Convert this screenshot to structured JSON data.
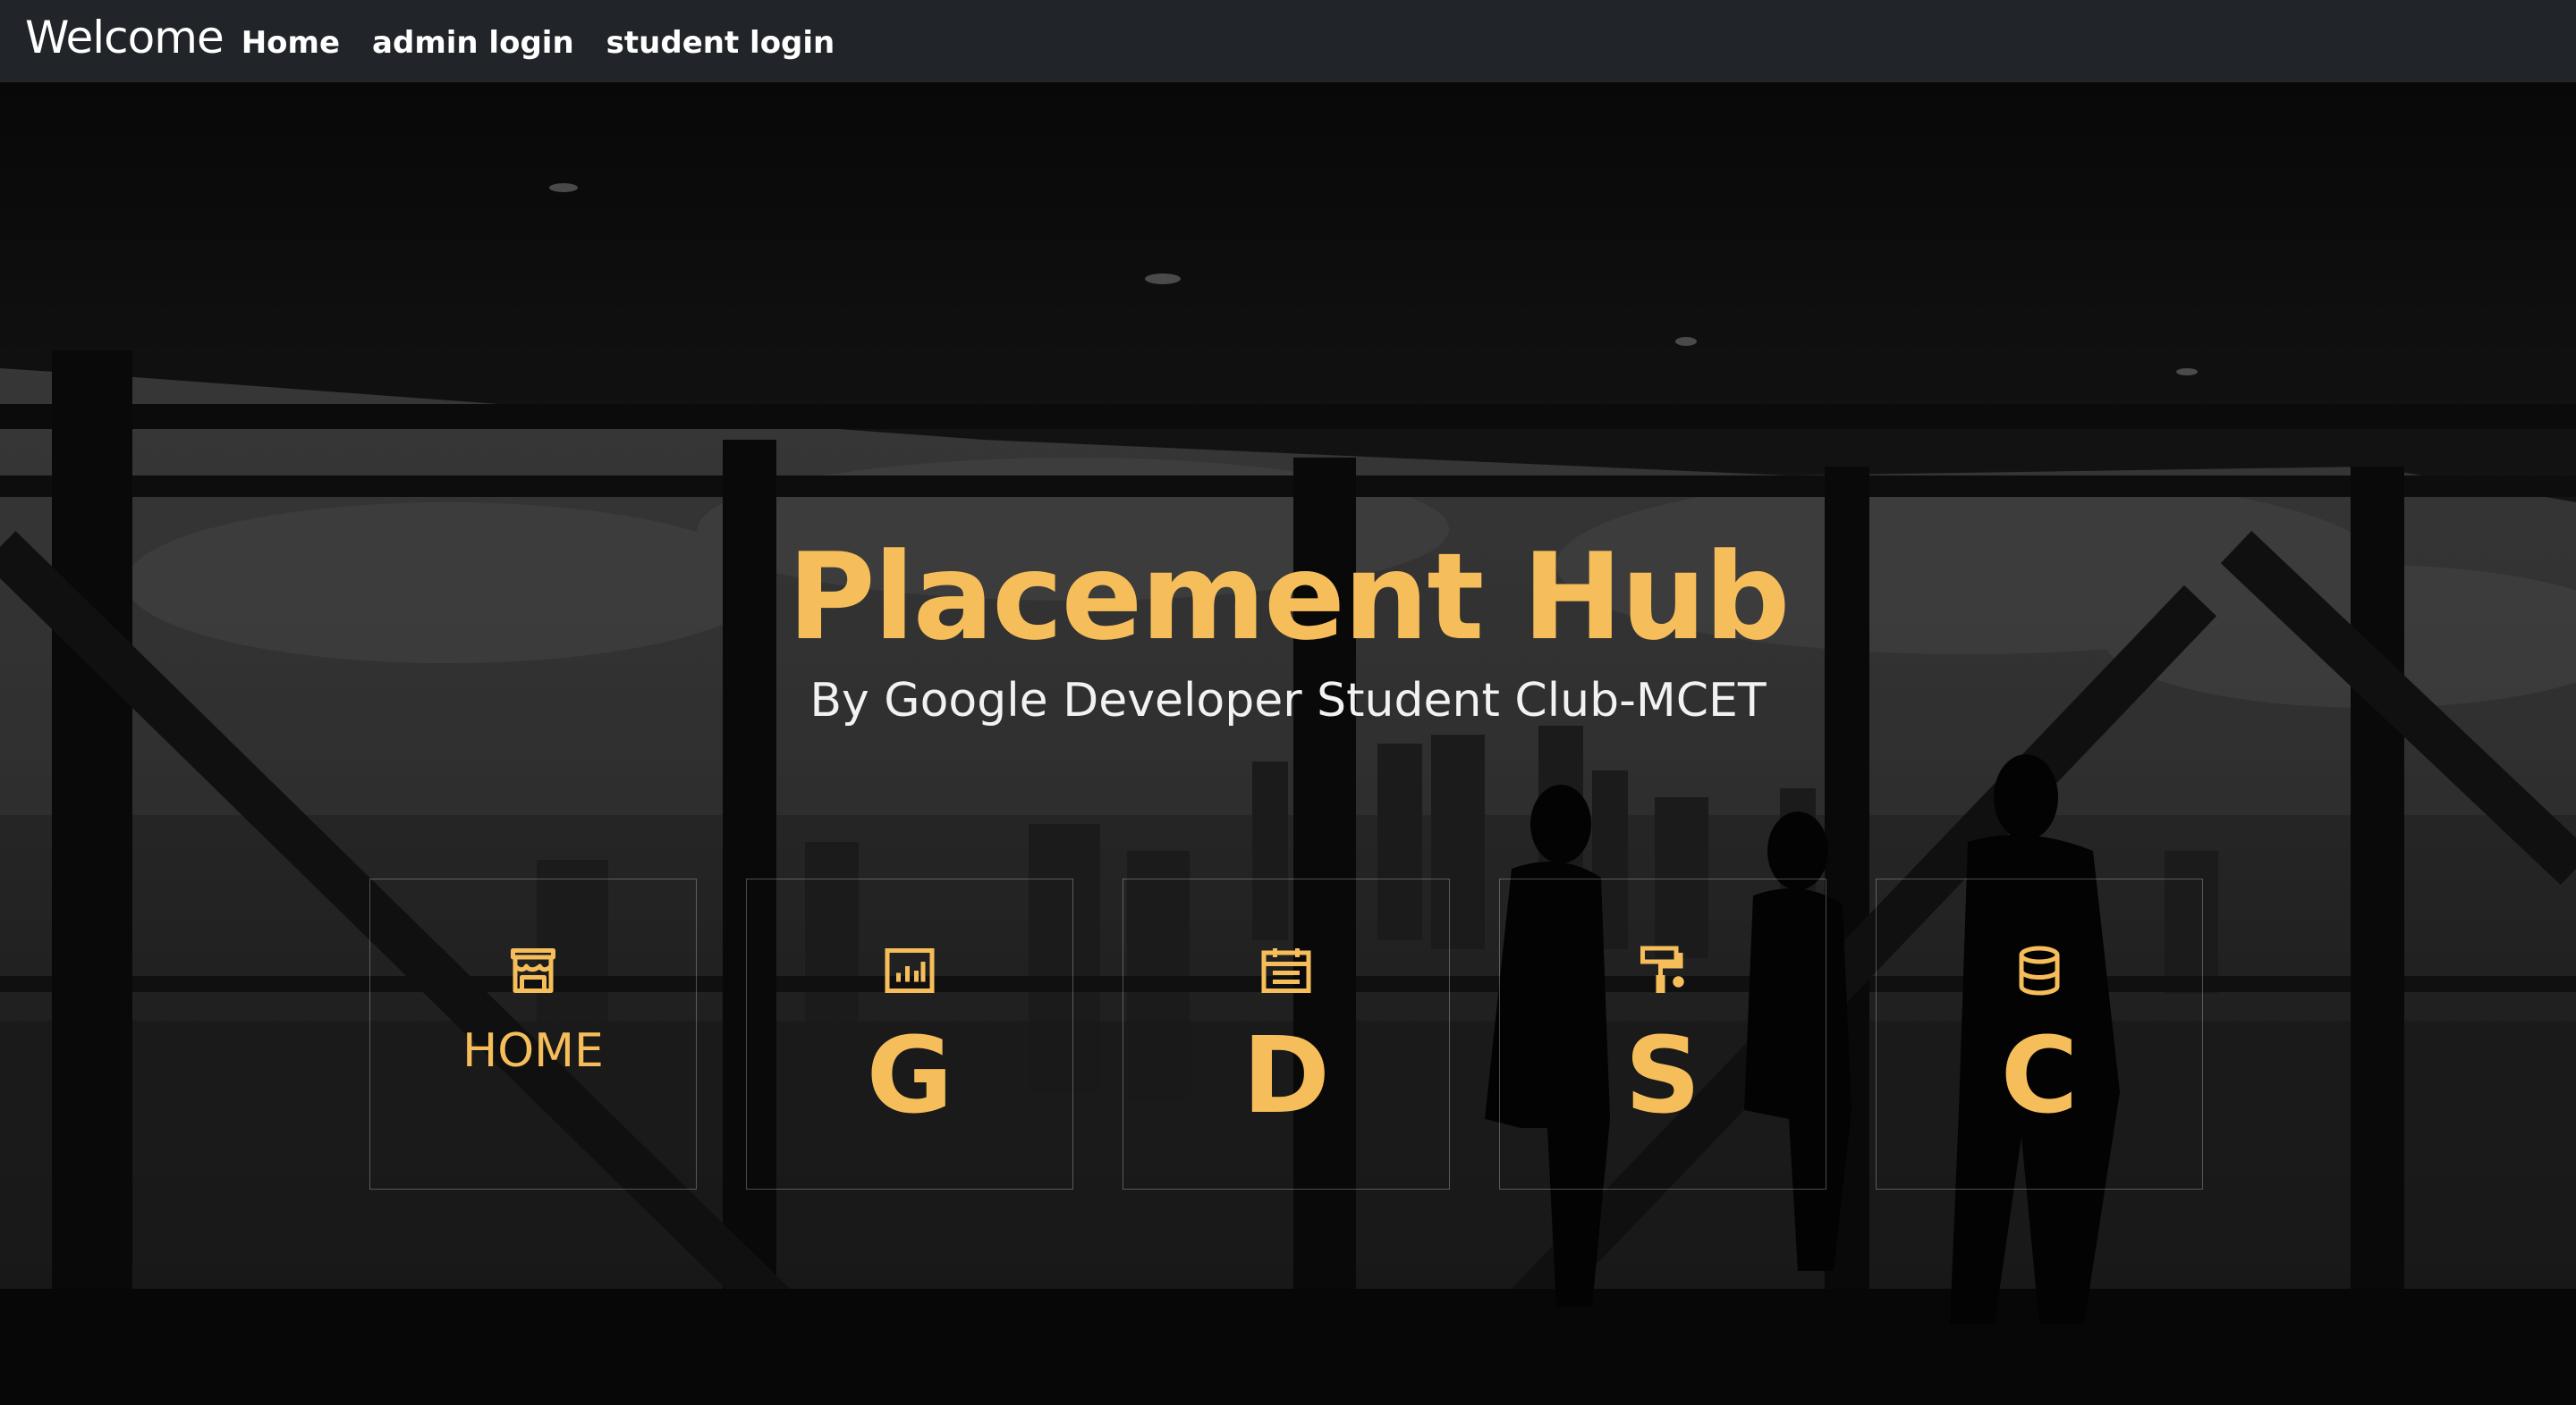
{
  "navbar": {
    "brand": "Welcome",
    "links": [
      {
        "label": "Home"
      },
      {
        "label": "admin login"
      },
      {
        "label": "student login"
      }
    ]
  },
  "hero": {
    "title": "Placement Hub",
    "subtitle": "By Google Developer Student Club-MCET"
  },
  "cards": [
    {
      "label": "HOME",
      "icon": "store-icon"
    },
    {
      "label": "G",
      "icon": "bar-chart-icon"
    },
    {
      "label": "D",
      "icon": "calendar-icon"
    },
    {
      "label": "S",
      "icon": "paint-roller-icon"
    },
    {
      "label": "C",
      "icon": "database-icon"
    }
  ],
  "colors": {
    "accent": "#f6be5a",
    "navbar_bg": "#212529",
    "text_light": "#f2f2f2"
  }
}
